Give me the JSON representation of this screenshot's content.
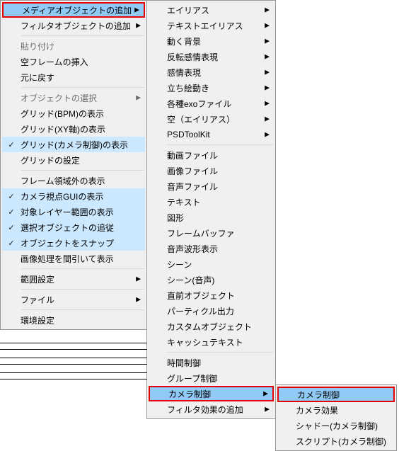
{
  "menu1": {
    "items": [
      {
        "label": "メディアオブジェクトの追加",
        "arrow": true,
        "hl": "blue",
        "red": true
      },
      {
        "label": "フィルタオブジェクトの追加",
        "arrow": true
      },
      {
        "sep": true
      },
      {
        "label": "貼り付け",
        "disabled": true
      },
      {
        "label": "空フレームの挿入"
      },
      {
        "label": "元に戻す"
      },
      {
        "sep": true
      },
      {
        "label": "オブジェクトの選択",
        "disabled": true,
        "arrow": true
      },
      {
        "label": "グリッド(BPM)の表示"
      },
      {
        "label": "グリッド(XY軸)の表示"
      },
      {
        "label": "グリッド(カメラ制御)の表示",
        "check": true
      },
      {
        "label": "グリッドの設定"
      },
      {
        "sep": true
      },
      {
        "label": "フレーム領域外の表示"
      },
      {
        "label": "カメラ視点GUIの表示",
        "check": true
      },
      {
        "label": "対象レイヤー範囲の表示",
        "check": true
      },
      {
        "label": "選択オブジェクトの追従",
        "check": true
      },
      {
        "label": "オブジェクトをスナップ",
        "check": true
      },
      {
        "label": "画像処理を間引いて表示"
      },
      {
        "sep": true
      },
      {
        "label": "範囲設定",
        "arrow": true
      },
      {
        "sep": true
      },
      {
        "label": "ファイル",
        "arrow": true
      },
      {
        "sep": true
      },
      {
        "label": "環境設定"
      }
    ]
  },
  "menu2": {
    "items": [
      {
        "label": "エイリアス",
        "arrow": true
      },
      {
        "label": "テキストエイリアス",
        "arrow": true
      },
      {
        "label": "動く背景",
        "arrow": true
      },
      {
        "label": "反転感情表現",
        "arrow": true
      },
      {
        "label": "感情表現",
        "arrow": true
      },
      {
        "label": "立ち絵動き",
        "arrow": true
      },
      {
        "label": "各種exoファイル",
        "arrow": true
      },
      {
        "label": "空（エイリアス）",
        "arrow": true
      },
      {
        "label": "PSDToolKit",
        "arrow": true
      },
      {
        "sep": true
      },
      {
        "label": "動画ファイル"
      },
      {
        "label": "画像ファイル"
      },
      {
        "label": "音声ファイル"
      },
      {
        "label": "テキスト"
      },
      {
        "label": "図形"
      },
      {
        "label": "フレームバッファ"
      },
      {
        "label": "音声波形表示"
      },
      {
        "label": "シーン"
      },
      {
        "label": "シーン(音声)"
      },
      {
        "label": "直前オブジェクト"
      },
      {
        "label": "パーティクル出力"
      },
      {
        "label": "カスタムオブジェクト"
      },
      {
        "label": "キャッシュテキスト"
      },
      {
        "sep": true
      },
      {
        "label": "時間制御"
      },
      {
        "label": "グループ制御"
      },
      {
        "label": "カメラ制御",
        "arrow": true,
        "hl": "blue",
        "red": true
      },
      {
        "label": "フィルタ効果の追加",
        "arrow": true
      }
    ]
  },
  "menu3": {
    "items": [
      {
        "label": "カメラ制御",
        "hl": "blue",
        "red": true
      },
      {
        "label": "カメラ効果"
      },
      {
        "label": "シャドー(カメラ制御)"
      },
      {
        "label": "スクリプト(カメラ制御)"
      }
    ]
  }
}
